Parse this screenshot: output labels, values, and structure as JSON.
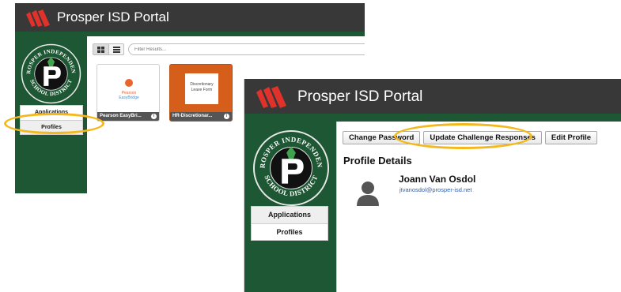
{
  "portal_title": "Prosper ISD Portal",
  "seal_text": {
    "top": "PROSPER INDEPENDENT",
    "bottom": "SCHOOL DISTRICT"
  },
  "nav": {
    "applications": "Applications",
    "profiles": "Profiles"
  },
  "apps_view": {
    "filter_placeholder": "Filter Results...",
    "tiles": [
      {
        "caption": "Pearson EasyBri...",
        "thumb_line1": "Pearson",
        "thumb_line2": "EasyBridge"
      },
      {
        "caption": "HR-Discretionar...",
        "thumb_line1": "Discretionary",
        "thumb_line2": "Leave Form"
      }
    ]
  },
  "profile_view": {
    "buttons": {
      "change_password": "Change Password",
      "update_challenge": "Update Challenge Responses",
      "edit_profile": "Edit Profile"
    },
    "section_title": "Profile Details",
    "user_name": "Joann Van Osdol",
    "user_email": "jtvanosdol@prosper-isd.net"
  },
  "colors": {
    "header": "#383838",
    "brand_green": "#1d5733",
    "logo_red": "#e0322b",
    "highlight": "#f5b81a",
    "link": "#2b5fb5"
  }
}
